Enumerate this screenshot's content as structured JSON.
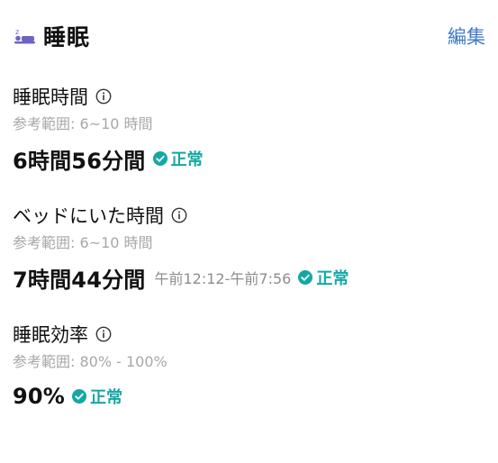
{
  "header": {
    "title": "睡眠",
    "edit_label": "編集",
    "icon": "sleep-icon"
  },
  "colors": {
    "accent": "#3f78c8",
    "normal_status": "#13a8a5",
    "muted_text": "#a7a7a7",
    "sleep_icon": "#6e62c8"
  },
  "metrics": [
    {
      "title": "睡眠時間",
      "reference": "参考範囲: 6~10 時間",
      "value": "6時間56分間",
      "status": "正常"
    },
    {
      "title": "ベッドにいた時間",
      "reference": "参考範囲: 6~10 時間",
      "value": "7時間44分間",
      "time_range": "午前12:12-午前7:56",
      "status": "正常"
    },
    {
      "title": "睡眠効率",
      "reference": "参考範囲: 80% - 100%",
      "value": "90%",
      "status": "正常"
    }
  ]
}
